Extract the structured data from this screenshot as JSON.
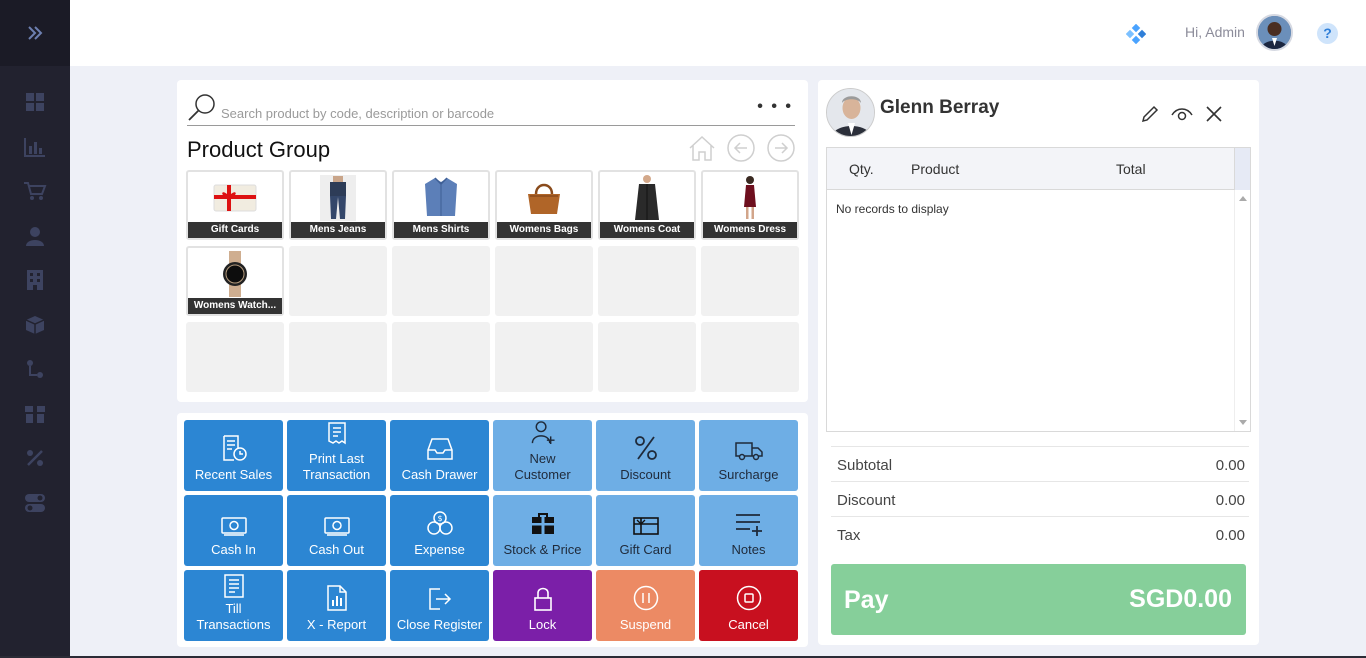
{
  "header": {
    "greeting": "Hi, Admin"
  },
  "search": {
    "placeholder": "Search product by code, description or barcode"
  },
  "product_group": {
    "title": "Product Group",
    "items": [
      {
        "label": "Gift Cards"
      },
      {
        "label": "Mens Jeans"
      },
      {
        "label": "Mens Shirts"
      },
      {
        "label": "Womens Bags"
      },
      {
        "label": "Womens Coat"
      },
      {
        "label": "Womens Dress"
      },
      {
        "label": "Womens Watch..."
      }
    ]
  },
  "actions": {
    "recent_sales": "Recent Sales",
    "print_last_1": "Print Last",
    "print_last_2": "Transaction",
    "cash_drawer": "Cash Drawer",
    "new_customer_1": "New",
    "new_customer_2": "Customer",
    "discount": "Discount",
    "surcharge": "Surcharge",
    "cash_in": "Cash In",
    "cash_out": "Cash Out",
    "expense": "Expense",
    "stock_price": "Stock & Price",
    "gift_card": "Gift Card",
    "notes": "Notes",
    "till_1": "Till",
    "till_2": "Transactions",
    "x_report": "X - Report",
    "close_register": "Close Register",
    "lock": "Lock",
    "suspend": "Suspend",
    "cancel": "Cancel"
  },
  "order": {
    "customer_name": "Glenn Berray",
    "columns": {
      "qty": "Qty.",
      "product": "Product",
      "total": "Total"
    },
    "empty_message": "No records to display",
    "subtotal_label": "Subtotal",
    "subtotal_value": "0.00",
    "discount_label": "Discount",
    "discount_value": "0.00",
    "tax_label": "Tax",
    "tax_value": "0.00",
    "pay_label": "Pay",
    "pay_amount": "SGD0.00"
  },
  "colors": {
    "sidebar": "#22222f",
    "action_dark": "#2c86d3",
    "action_light": "#6eaee5",
    "lock": "#7b1fa8",
    "suspend": "#ec8a64",
    "cancel": "#c8101f",
    "pay": "#86cf9a"
  }
}
